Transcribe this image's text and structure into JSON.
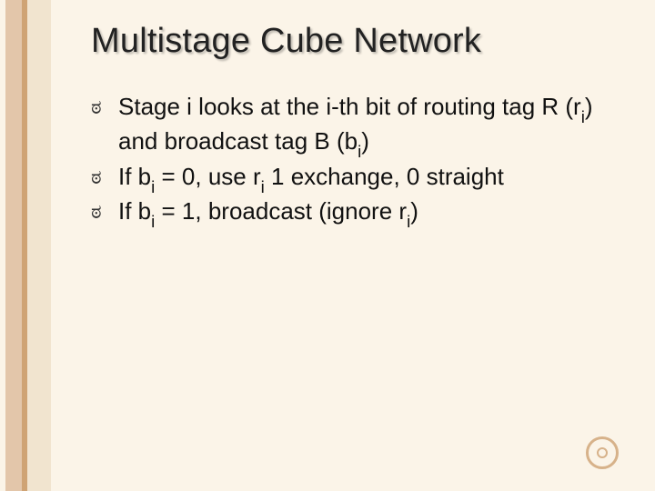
{
  "title": "Multistage Cube Network",
  "bullets": [
    {
      "segments": [
        {
          "t": "Stage i looks at the i-th bit of routing tag R (r"
        },
        {
          "t": "i",
          "sub": true
        },
        {
          "t": ") and broadcast tag B (b"
        },
        {
          "t": "i",
          "sub": true
        },
        {
          "t": ")"
        }
      ]
    },
    {
      "segments": [
        {
          "t": "If b"
        },
        {
          "t": "i",
          "sub": true
        },
        {
          "t": " = 0, use r"
        },
        {
          "t": "i",
          "sub": true
        },
        {
          "t": " 1 exchange, 0 straight"
        }
      ]
    },
    {
      "segments": [
        {
          "t": "If b"
        },
        {
          "t": "i",
          "sub": true
        },
        {
          "t": " = 1, broadcast (ignore r"
        },
        {
          "t": "i",
          "sub": true
        },
        {
          "t": ")"
        }
      ]
    }
  ],
  "glyphs": {
    "bullet": "ಠ"
  }
}
